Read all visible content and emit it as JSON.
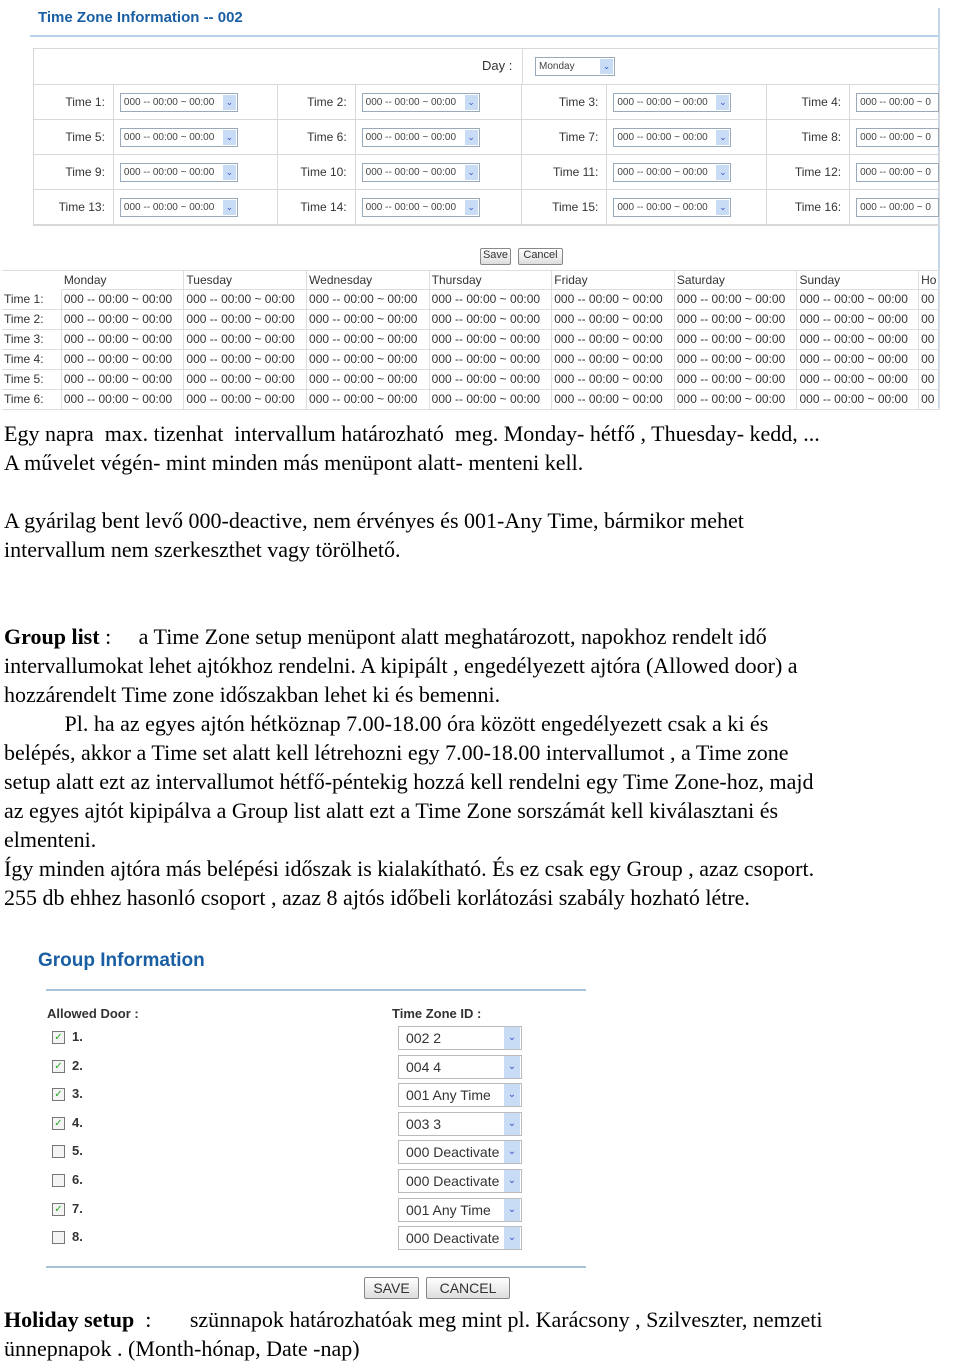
{
  "timezone": {
    "title": "Time Zone Information -- 002",
    "day_label": "Day :",
    "day_value": "Monday",
    "times": [
      {
        "label": "Time 1:",
        "value": "000 -- 00:00 ~ 00:00"
      },
      {
        "label": "Time 2:",
        "value": "000 -- 00:00 ~ 00:00"
      },
      {
        "label": "Time 3:",
        "value": "000 -- 00:00 ~ 00:00"
      },
      {
        "label": "Time 4:",
        "value": "000 -- 00:00 ~ 0"
      },
      {
        "label": "Time 5:",
        "value": "000 -- 00:00 ~ 00:00"
      },
      {
        "label": "Time 6:",
        "value": "000 -- 00:00 ~ 00:00"
      },
      {
        "label": "Time 7:",
        "value": "000 -- 00:00 ~ 00:00"
      },
      {
        "label": "Time 8:",
        "value": "000 -- 00:00 ~ 0"
      },
      {
        "label": "Time 9:",
        "value": "000 -- 00:00 ~ 00:00"
      },
      {
        "label": "Time 10:",
        "value": "000 -- 00:00 ~ 00:00"
      },
      {
        "label": "Time 11:",
        "value": "000 -- 00:00 ~ 00:00"
      },
      {
        "label": "Time 12:",
        "value": "000 -- 00:00 ~ 0"
      },
      {
        "label": "Time 13:",
        "value": "000 -- 00:00 ~ 00:00"
      },
      {
        "label": "Time 14:",
        "value": "000 -- 00:00 ~ 00:00"
      },
      {
        "label": "Time 15:",
        "value": "000 -- 00:00 ~ 00:00"
      },
      {
        "label": "Time 16:",
        "value": "000 -- 00:00 ~ 0"
      }
    ],
    "save": "Save",
    "cancel": "Cancel"
  },
  "week_table": {
    "headers": [
      "",
      "Monday",
      "Tuesday",
      "Wednesday",
      "Thursday",
      "Friday",
      "Saturday",
      "Sunday",
      "Ho"
    ],
    "rows": [
      {
        "label": "Time 1:",
        "cells": [
          "000 -- 00:00 ~ 00:00",
          "000 -- 00:00 ~ 00:00",
          "000 -- 00:00 ~ 00:00",
          "000 -- 00:00 ~ 00:00",
          "000 -- 00:00 ~ 00:00",
          "000 -- 00:00 ~ 00:00",
          "000 -- 00:00 ~ 00:00",
          "00"
        ]
      },
      {
        "label": "Time 2:",
        "cells": [
          "000 -- 00:00 ~ 00:00",
          "000 -- 00:00 ~ 00:00",
          "000 -- 00:00 ~ 00:00",
          "000 -- 00:00 ~ 00:00",
          "000 -- 00:00 ~ 00:00",
          "000 -- 00:00 ~ 00:00",
          "000 -- 00:00 ~ 00:00",
          "00"
        ]
      },
      {
        "label": "Time 3:",
        "cells": [
          "000 -- 00:00 ~ 00:00",
          "000 -- 00:00 ~ 00:00",
          "000 -- 00:00 ~ 00:00",
          "000 -- 00:00 ~ 00:00",
          "000 -- 00:00 ~ 00:00",
          "000 -- 00:00 ~ 00:00",
          "000 -- 00:00 ~ 00:00",
          "00"
        ]
      },
      {
        "label": "Time 4:",
        "cells": [
          "000 -- 00:00 ~ 00:00",
          "000 -- 00:00 ~ 00:00",
          "000 -- 00:00 ~ 00:00",
          "000 -- 00:00 ~ 00:00",
          "000 -- 00:00 ~ 00:00",
          "000 -- 00:00 ~ 00:00",
          "000 -- 00:00 ~ 00:00",
          "00"
        ]
      },
      {
        "label": "Time 5:",
        "cells": [
          "000 -- 00:00 ~ 00:00",
          "000 -- 00:00 ~ 00:00",
          "000 -- 00:00 ~ 00:00",
          "000 -- 00:00 ~ 00:00",
          "000 -- 00:00 ~ 00:00",
          "000 -- 00:00 ~ 00:00",
          "000 -- 00:00 ~ 00:00",
          "00"
        ]
      },
      {
        "label": "Time 6:",
        "cells": [
          "000 -- 00:00 ~ 00:00",
          "000 -- 00:00 ~ 00:00",
          "000 -- 00:00 ~ 00:00",
          "000 -- 00:00 ~ 00:00",
          "000 -- 00:00 ~ 00:00",
          "000 -- 00:00 ~ 00:00",
          "000 -- 00:00 ~ 00:00",
          "00"
        ]
      }
    ]
  },
  "text1": {
    "lines": [
      "Egy napra  max. tizenhat  intervallum határozható  meg. Monday- hétfő , Thuesday- kedd, ...",
      "A művelet végén- mint minden más menüpont alatt- menteni kell."
    ]
  },
  "text2": {
    "lines": [
      "A gyárilag bent levő 000-deactive, nem érvényes és 001-Any Time, bármikor mehet",
      "intervallum nem szerkeszthet vagy törölhető."
    ]
  },
  "text3": {
    "bold": "Group list",
    "first_rest": " :     a Time Zone setup menüpont alatt meghatározott, napokhoz rendelt idő",
    "lines": [
      "intervallumokat lehet ajtókhoz rendelni. A kipipált , engedélyezett ajtóra (Allowed door) a",
      "hozzárendelt Time zone időszakban lehet ki és bemenni.",
      "           Pl. ha az egyes ajtón hétköznap 7.00-18.00 óra között engedélyezett csak a ki és",
      "belépés, akkor a Time set alatt kell létrehozni egy 7.00-18.00 intervallumot , a Time zone",
      "setup alatt ezt az intervallumot hétfő-péntekig hozzá kell rendelni egy Time Zone-hoz, majd",
      "az egyes ajtót kipipálva a Group list alatt ezt a Time Zone sorszámát kell kiválasztani és",
      "elmenteni.",
      "Így minden ajtóra más belépési időszak is kialakítható. És ez csak egy Group , azaz csoport.",
      "255 db ehhez hasonló csoport , azaz 8 ajtós időbeli korlátozási szabály hozható létre."
    ]
  },
  "group": {
    "title": "Group Information",
    "allowed_door_label": "Allowed Door :",
    "tz_label": "Time Zone ID :",
    "doors": [
      {
        "num": "1.",
        "checked": true,
        "tz": "002 2"
      },
      {
        "num": "2.",
        "checked": true,
        "tz": "004 4"
      },
      {
        "num": "3.",
        "checked": true,
        "tz": "001 Any Time"
      },
      {
        "num": "4.",
        "checked": true,
        "tz": "003 3"
      },
      {
        "num": "5.",
        "checked": false,
        "tz": "000 Deactivate"
      },
      {
        "num": "6.",
        "checked": false,
        "tz": "000 Deactivate"
      },
      {
        "num": "7.",
        "checked": true,
        "tz": "001 Any Time"
      },
      {
        "num": "8.",
        "checked": false,
        "tz": "000 Deactivate"
      }
    ],
    "save": "SAVE",
    "cancel": "CANCEL"
  },
  "text4": {
    "bold": "Holiday setup",
    "first_rest": "  :       szünnapok határozhatóak meg mint pl. Karácsony , Szilveszter, nemzeti",
    "lines": [
      "ünnepnapok . (Month-hónap, Date -nap)"
    ]
  },
  "colors": {
    "title_blue": "#1a5fa3",
    "check_green": "#22aa22"
  }
}
